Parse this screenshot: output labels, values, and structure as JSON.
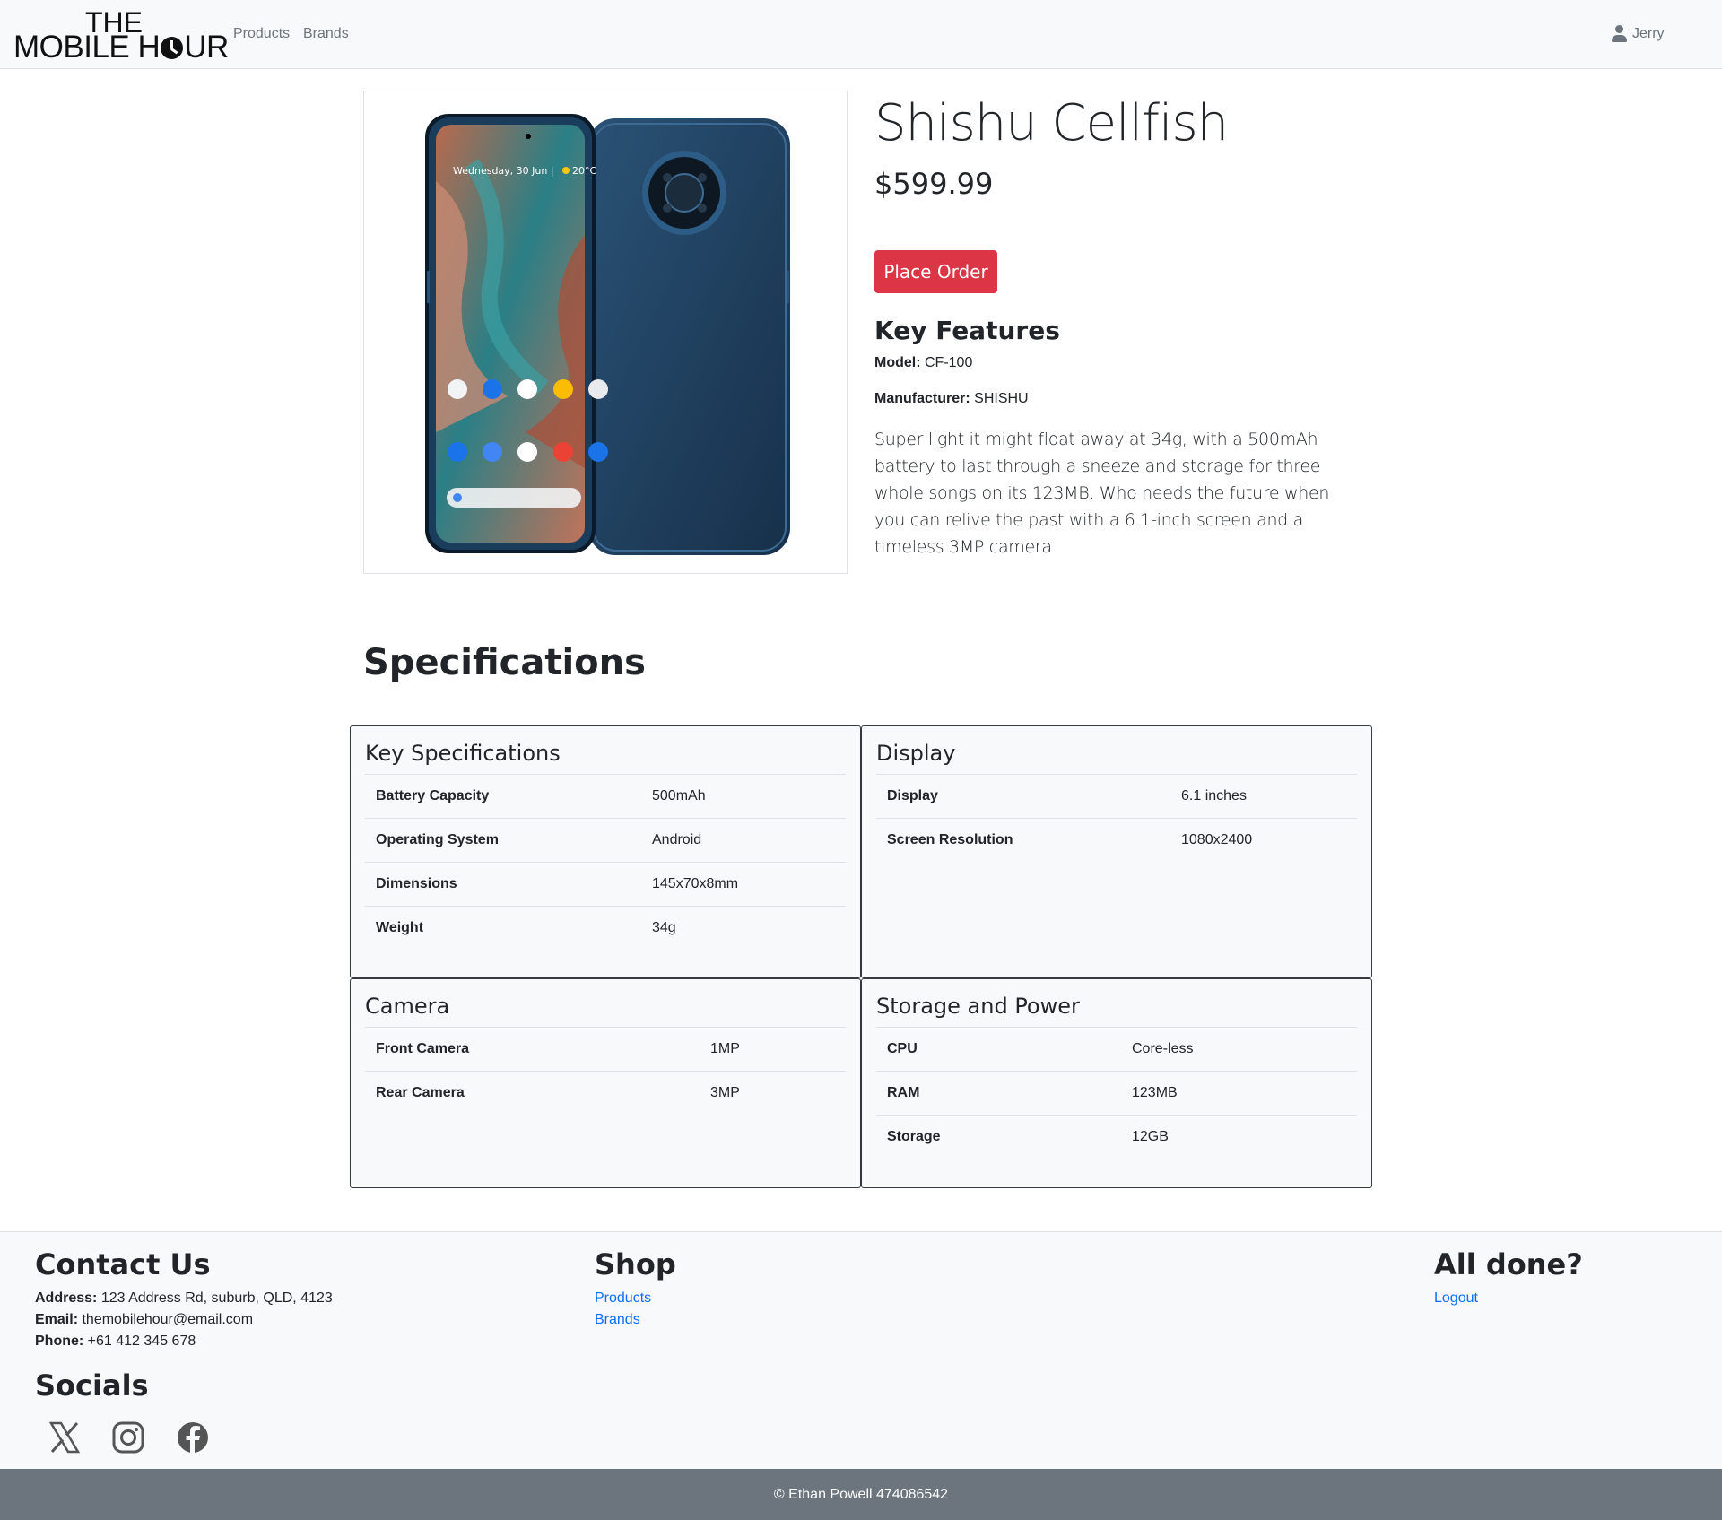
{
  "brand": {
    "top": "THE",
    "main_left": "MOBILE H",
    "main_right": "UR"
  },
  "nav": {
    "products": "Products",
    "brands": "Brands",
    "user": "Jerry"
  },
  "product": {
    "title": "Shishu Cellfish",
    "price": "$599.99",
    "order_label": "Place Order",
    "features_heading": "Key Features",
    "model_label": "Model:",
    "model_value": "CF-100",
    "manufacturer_label": "Manufacturer:",
    "manufacturer_value": "SHISHU",
    "description": "Super light it might float away at 34g, with a 500mAh battery to last through a sneeze and storage for three whole songs on its 123MB. Who needs the future when you can relive the past with a 6.1-inch screen and a timeless 3MP camera",
    "image_text": {
      "clock": "Wednesday, 30 Jun | ",
      "temp": "20°C"
    }
  },
  "specs": {
    "heading": "Specifications",
    "key_specs": {
      "title": "Key Specifications",
      "rows": [
        {
          "label": "Battery Capacity",
          "value": "500mAh"
        },
        {
          "label": "Operating System",
          "value": "Android"
        },
        {
          "label": "Dimensions",
          "value": "145x70x8mm"
        },
        {
          "label": "Weight",
          "value": "34g"
        }
      ]
    },
    "display": {
      "title": "Display",
      "rows": [
        {
          "label": "Display",
          "value": "6.1 inches"
        },
        {
          "label": "Screen Resolution",
          "value": "1080x2400"
        }
      ]
    },
    "camera": {
      "title": "Camera",
      "rows": [
        {
          "label": "Front Camera",
          "value": "1MP"
        },
        {
          "label": "Rear Camera",
          "value": "3MP"
        }
      ]
    },
    "storage": {
      "title": "Storage and Power",
      "rows": [
        {
          "label": "CPU",
          "value": "Core-less"
        },
        {
          "label": "RAM",
          "value": "123MB"
        },
        {
          "label": "Storage",
          "value": "12GB"
        }
      ]
    }
  },
  "footer": {
    "contact_heading": "Contact Us",
    "address_label": "Address:",
    "address_value": "123 Address Rd, suburb, QLD, 4123",
    "email_label": "Email:",
    "email_value": "themobilehour@email.com",
    "phone_label": "Phone:",
    "phone_value": "+61 412 345 678",
    "shop_heading": "Shop",
    "shop_products": "Products",
    "shop_brands": "Brands",
    "done_heading": "All done?",
    "logout": "Logout",
    "socials_heading": "Socials",
    "social_icons": [
      "x-icon",
      "instagram-icon",
      "facebook-icon"
    ],
    "copyright": "© Ethan Powell 474086542"
  },
  "colors": {
    "accent_red": "#dc3545",
    "link_blue": "#0d6efd",
    "navbar_bg": "#f8f9fa",
    "footer_bar": "#6c757d",
    "phone_body": "#1f3f5e"
  }
}
